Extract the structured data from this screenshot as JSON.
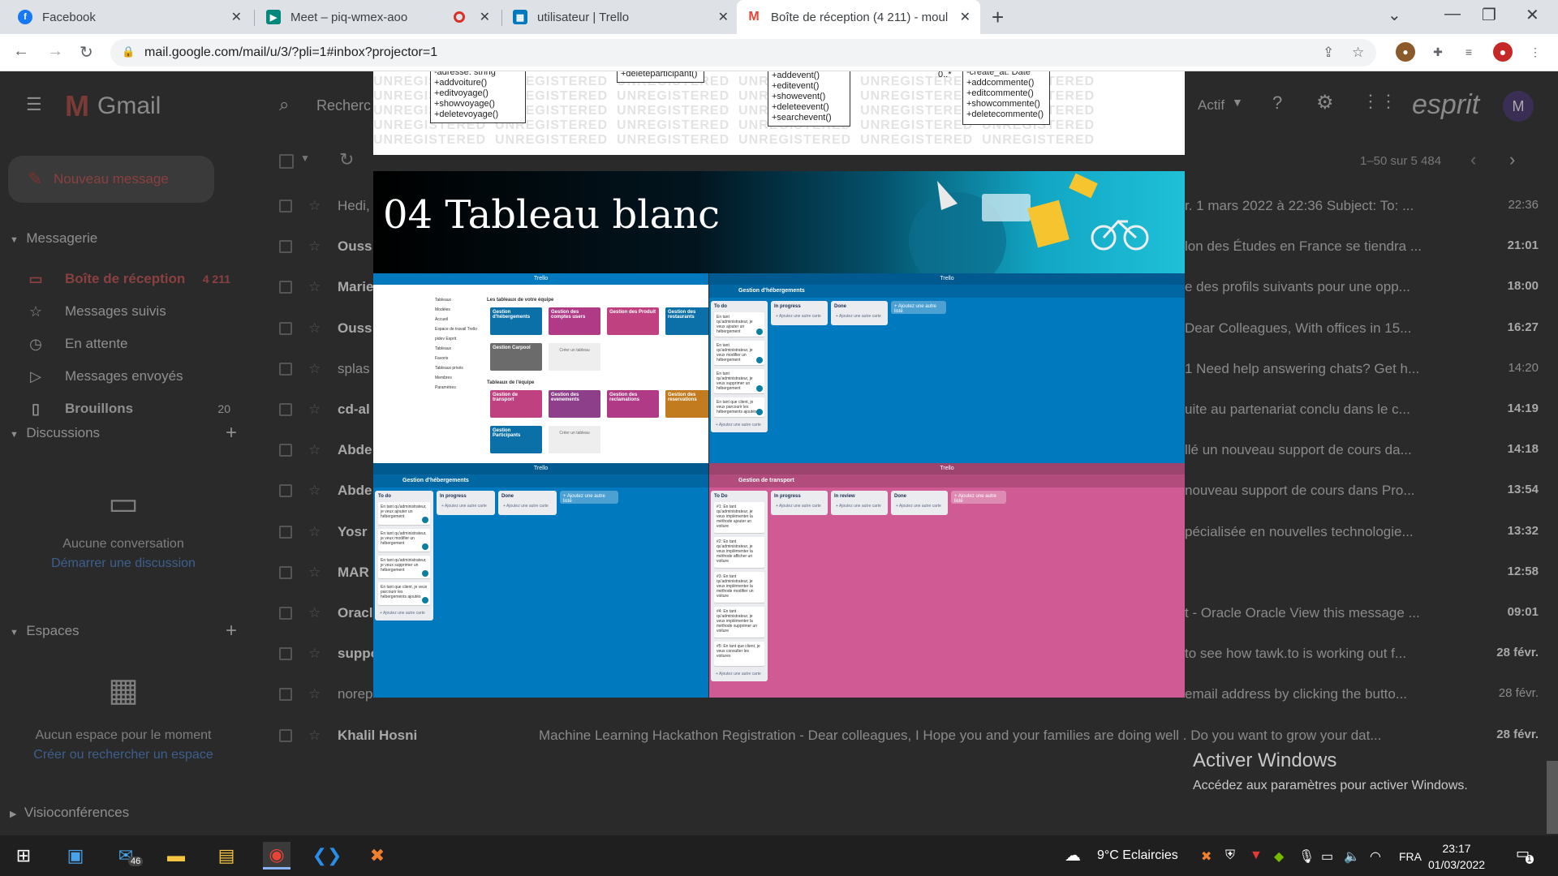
{
  "browser": {
    "tabs": [
      {
        "title": "Facebook",
        "color": "#1877f2",
        "glyph": "f"
      },
      {
        "title": "Meet – piq-wmex-aoo",
        "color": "#00897b",
        "glyph": "▶"
      },
      {
        "title": "utilisateur | Trello",
        "color": "#0079bf",
        "glyph": "▦"
      },
      {
        "title": "Boîte de réception (4 211) - moul",
        "color": "#ea4335",
        "glyph": "M"
      }
    ],
    "url": "mail.google.com/mail/u/3/?pli=1#inbox?projector=1"
  },
  "gmail": {
    "app_name": "Gmail",
    "search_placeholder": "Recherc",
    "status": "Actif",
    "brand": "esprit",
    "avatar": "M",
    "compose": "Nouveau message",
    "section_mail": "Messagerie",
    "nav": [
      {
        "label": "Boîte de réception",
        "count": "4 211",
        "icon": "inbox-icon",
        "glyph": "▭"
      },
      {
        "label": "Messages suivis",
        "count": "",
        "icon": "star-icon",
        "glyph": "☆"
      },
      {
        "label": "En attente",
        "count": "",
        "icon": "clock-icon",
        "glyph": "◷"
      },
      {
        "label": "Messages envoyés",
        "count": "",
        "icon": "send-icon",
        "glyph": "▷"
      },
      {
        "label": "Brouillons",
        "count": "20",
        "icon": "draft-icon",
        "glyph": "▯"
      }
    ],
    "discussions_title": "Discussions",
    "discussions_empty": "Aucune conversation",
    "discussions_link": "Démarrer une discussion",
    "spaces_title": "Espaces",
    "spaces_empty": "Aucun espace pour le moment",
    "spaces_link": "Créer ou rechercher un espace",
    "meet_title": "Visioconférences",
    "pagination": "1–50 sur 5 484",
    "emails": [
      {
        "sender": "Hedi,",
        "snippet": "r. 1 mars 2022 à 22:36 Subject: To: ...",
        "time": "22:36",
        "bold": false
      },
      {
        "sender": "Ouss",
        "snippet": "lon des Études en France se tiendra ...",
        "time": "21:01",
        "bold": true
      },
      {
        "sender": "Marie",
        "snippet": "e des profils suivants pour une opp...",
        "time": "18:00",
        "bold": true
      },
      {
        "sender": "Ouss",
        "snippet": "Dear Colleagues, With offices in 15...",
        "time": "16:27",
        "bold": true
      },
      {
        "sender": "splas",
        "snippet": "1 Need help answering chats? Get h...",
        "time": "14:20",
        "bold": false
      },
      {
        "sender": "cd-al",
        "snippet": "uite au partenariat conclu dans le c...",
        "time": "14:19",
        "bold": true
      },
      {
        "sender": "Abde",
        "snippet": "llé un nouveau support de cours da...",
        "time": "14:18",
        "bold": true
      },
      {
        "sender": "Abde",
        "snippet": "nouveau support de cours dans Pro...",
        "time": "13:54",
        "bold": true
      },
      {
        "sender": "Yosr",
        "snippet": "pécialisée en nouvelles technologie...",
        "time": "13:32",
        "bold": true
      },
      {
        "sender": "MAR",
        "snippet": "",
        "time": "12:58",
        "bold": true
      },
      {
        "sender": "Oracl",
        "snippet": "t - Oracle Oracle View this message ...",
        "time": "09:01",
        "bold": true
      },
      {
        "sender": "suppo",
        "snippet": "to see how tawk.to is working out f...",
        "time": "28 févr.",
        "bold": true
      },
      {
        "sender": "norep",
        "snippet": "email address by clicking the butto...",
        "time": "28 févr.",
        "bold": false
      },
      {
        "sender": "Khalil Hosni",
        "snippet": "Machine Learning Hackathon Registration - Dear colleagues, I Hope you and your families are doing well . Do you want to grow your dat...",
        "time": "28 févr.",
        "bold": true
      }
    ]
  },
  "slide": {
    "title": "04 Tableau blanc",
    "watermark": "UNREGISTERED",
    "uml_boxes": [
      {
        "lines": [
          "-adresse: string",
          "+addvoiture()",
          "+editvoyage()",
          "+showvoyage()",
          "+deletevoyage()"
        ]
      },
      {
        "lines": [
          "+deleteparticipant()"
        ]
      },
      {
        "lines": [
          "+addevent()",
          "+editevent()",
          "+showevent()",
          "+deleteevent()",
          "+searchevent()"
        ]
      },
      {
        "lines": [
          "-create_at: Date",
          "+addcommente()",
          "+editcommente()",
          "+showcommente()",
          "+deletecommente()"
        ]
      }
    ],
    "multiplicity": "0..*",
    "trello_home": {
      "menu": [
        "Tableaux",
        "Modèles",
        "Accueil",
        "Espace de travail Trello",
        "pidev Esprit",
        "Tableaux",
        "Favoris",
        "Tableaux privés",
        "Membres",
        "Paramètres"
      ],
      "section1": "Les tableaux de votre équipe",
      "section2": "Tableaux de l'équipe",
      "tiles1": [
        {
          "label": "Gestion d'hébergements",
          "color": "#0b6fa8"
        },
        {
          "label": "Gestion des comptes users",
          "color": "#b03a86"
        },
        {
          "label": "Gestion des Produit",
          "color": "#c0417f"
        },
        {
          "label": "Gestion des restaurants",
          "color": "#0b6fa8"
        },
        {
          "label": "Gestion Carpool",
          "color": "#6b6b6b"
        }
      ],
      "tiles2": [
        {
          "label": "Gestion de transport",
          "color": "#c0417f"
        },
        {
          "label": "Gestion des evenements",
          "color": "#8e3f8a"
        },
        {
          "label": "Gestion des reclamations",
          "color": "#b03a86"
        },
        {
          "label": "Gestion des reservations",
          "color": "#c27c1f"
        },
        {
          "label": "Gestion Participants",
          "color": "#0b6fa8"
        }
      ],
      "create": "Créer un tableau"
    },
    "board_heb": {
      "title": "Gestion d'hébergements",
      "lists": [
        "To do",
        "In progress",
        "Done"
      ],
      "add_list": "+ Ajoutez une autre liste",
      "cards": [
        "En tant qu'administrateur, je veux ajouter un hébergement",
        "En tant qu'administrateur, je veux modifier un hébergement",
        "En tant qu'administrateur, je veux supprimer un hébergement",
        "En tant que client, je veux parcourir les hébergements ajoutés"
      ],
      "add_card": "+ Ajoutez une autre carte"
    },
    "board_transport": {
      "title": "Gestion de transport",
      "lists": [
        "To Do",
        "In progress",
        "In review",
        "Done"
      ],
      "add_list": "+ Ajoutez une autre liste",
      "cards": [
        "#1: En tant qu'administrateur, je veux implémenter la méthode ajouter un voiture",
        "#2: En tant qu'administrateur, je veux implémenter la méthode afficher un voiture",
        "#3: En tant qu'administrateur, je veux implémenter la méthode modifier un voiture",
        "#4: En tant qu'administrateur, je veux implémenter la méthode supprimer un voiture",
        "#5: En tant que client, je veux consulter les voitures"
      ],
      "add_card": "+ Ajoutez une autre carte"
    }
  },
  "windows": {
    "activate_title": "Activer Windows",
    "activate_sub": "Accédez aux paramètres pour activer Windows.",
    "mail_badge": "46",
    "weather": "9°C  Eclaircies",
    "lang": "FRA",
    "time": "23:17",
    "date": "01/03/2022",
    "notif": "1"
  }
}
